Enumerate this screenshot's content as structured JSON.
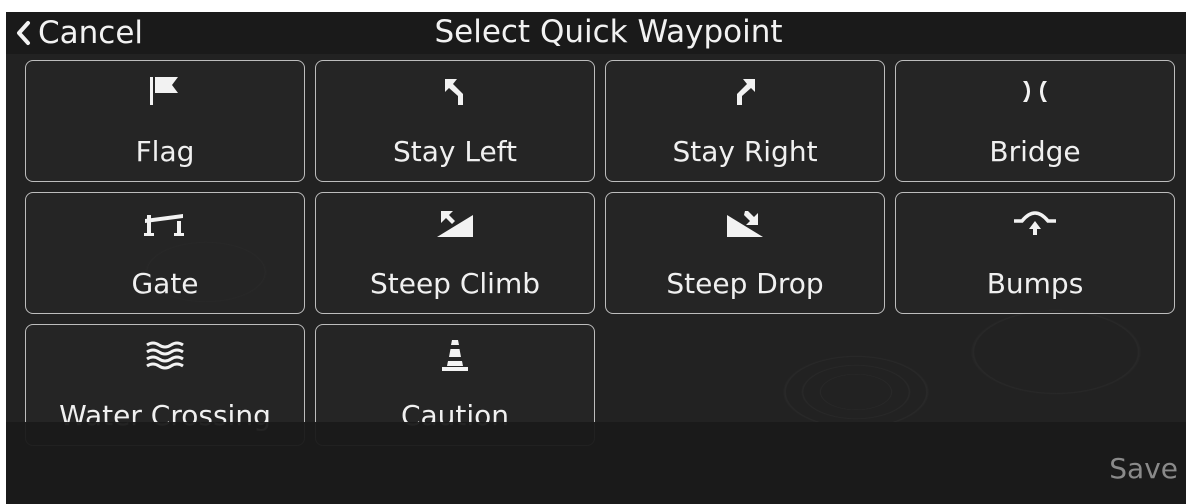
{
  "header": {
    "cancel_label": "Cancel",
    "title": "Select Quick Waypoint"
  },
  "waypoints": [
    {
      "label": "Flag",
      "icon": "flag-icon"
    },
    {
      "label": "Stay Left",
      "icon": "stay-left-arrow-icon"
    },
    {
      "label": "Stay Right",
      "icon": "stay-right-arrow-icon"
    },
    {
      "label": "Bridge",
      "icon": "bridge-icon"
    },
    {
      "label": "Gate",
      "icon": "gate-icon"
    },
    {
      "label": "Steep Climb",
      "icon": "steep-climb-icon"
    },
    {
      "label": "Steep Drop",
      "icon": "steep-drop-icon"
    },
    {
      "label": "Bumps",
      "icon": "bumps-icon"
    },
    {
      "label": "Water Crossing",
      "icon": "water-crossing-icon"
    },
    {
      "label": "Caution",
      "icon": "caution-cone-icon"
    }
  ],
  "footer": {
    "save_label": "Save"
  },
  "colors": {
    "background": "#222222",
    "header": "#1a1a1a",
    "text": "#f2f2f2",
    "tile_border": "#bdbdbd",
    "save_disabled": "#8a8a8a"
  }
}
